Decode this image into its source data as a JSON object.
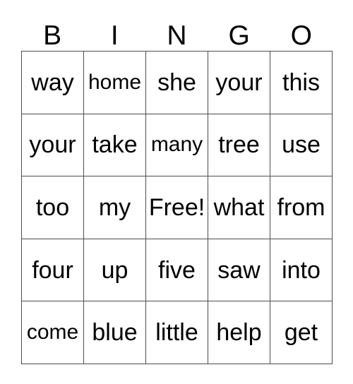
{
  "card": {
    "title": "BINGO",
    "free_space_label": "Free!",
    "border_color": "#4d4d4d",
    "text_color": "#000000",
    "background_color": "#ffffff",
    "columns": 5,
    "rows": 5,
    "headers": [
      {
        "letter": "B"
      },
      {
        "letter": "I"
      },
      {
        "letter": "N"
      },
      {
        "letter": "G"
      },
      {
        "letter": "O"
      }
    ],
    "grid": [
      [
        {
          "word": "way",
          "size": "normal"
        },
        {
          "word": "home",
          "size": "shrink-1"
        },
        {
          "word": "she",
          "size": "normal"
        },
        {
          "word": "your",
          "size": "normal"
        },
        {
          "word": "this",
          "size": "normal"
        }
      ],
      [
        {
          "word": "your",
          "size": "normal"
        },
        {
          "word": "take",
          "size": "normal"
        },
        {
          "word": "many",
          "size": "shrink-1"
        },
        {
          "word": "tree",
          "size": "normal"
        },
        {
          "word": "use",
          "size": "normal"
        }
      ],
      [
        {
          "word": "too",
          "size": "normal"
        },
        {
          "word": "my",
          "size": "normal"
        },
        {
          "word": "Free!",
          "size": "normal"
        },
        {
          "word": "what",
          "size": "normal"
        },
        {
          "word": "from",
          "size": "normal"
        }
      ],
      [
        {
          "word": "four",
          "size": "normal"
        },
        {
          "word": "up",
          "size": "normal"
        },
        {
          "word": "five",
          "size": "normal"
        },
        {
          "word": "saw",
          "size": "normal"
        },
        {
          "word": "into",
          "size": "normal"
        }
      ],
      [
        {
          "word": "come",
          "size": "shrink-1"
        },
        {
          "word": "blue",
          "size": "normal"
        },
        {
          "word": "little",
          "size": "normal"
        },
        {
          "word": "help",
          "size": "normal"
        },
        {
          "word": "get",
          "size": "normal"
        }
      ]
    ]
  }
}
